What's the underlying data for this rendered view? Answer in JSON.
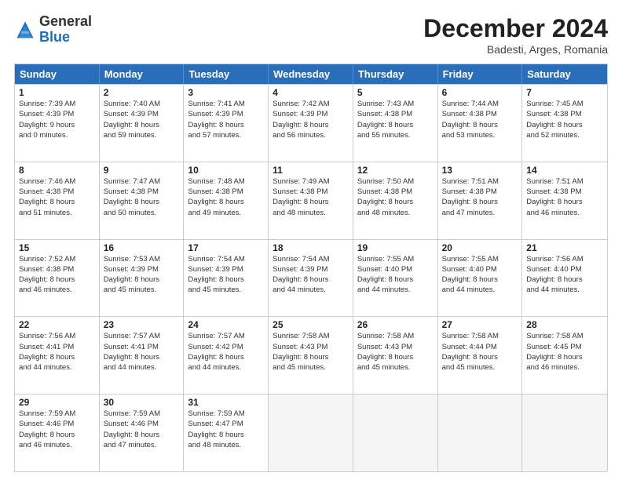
{
  "header": {
    "logo_general": "General",
    "logo_blue": "Blue",
    "month_title": "December 2024",
    "subtitle": "Badesti, Arges, Romania"
  },
  "days_of_week": [
    "Sunday",
    "Monday",
    "Tuesday",
    "Wednesday",
    "Thursday",
    "Friday",
    "Saturday"
  ],
  "weeks": [
    [
      {
        "day": "1",
        "lines": [
          "Sunrise: 7:39 AM",
          "Sunset: 4:39 PM",
          "Daylight: 9 hours",
          "and 0 minutes."
        ]
      },
      {
        "day": "2",
        "lines": [
          "Sunrise: 7:40 AM",
          "Sunset: 4:39 PM",
          "Daylight: 8 hours",
          "and 59 minutes."
        ]
      },
      {
        "day": "3",
        "lines": [
          "Sunrise: 7:41 AM",
          "Sunset: 4:39 PM",
          "Daylight: 8 hours",
          "and 57 minutes."
        ]
      },
      {
        "day": "4",
        "lines": [
          "Sunrise: 7:42 AM",
          "Sunset: 4:39 PM",
          "Daylight: 8 hours",
          "and 56 minutes."
        ]
      },
      {
        "day": "5",
        "lines": [
          "Sunrise: 7:43 AM",
          "Sunset: 4:38 PM",
          "Daylight: 8 hours",
          "and 55 minutes."
        ]
      },
      {
        "day": "6",
        "lines": [
          "Sunrise: 7:44 AM",
          "Sunset: 4:38 PM",
          "Daylight: 8 hours",
          "and 53 minutes."
        ]
      },
      {
        "day": "7",
        "lines": [
          "Sunrise: 7:45 AM",
          "Sunset: 4:38 PM",
          "Daylight: 8 hours",
          "and 52 minutes."
        ]
      }
    ],
    [
      {
        "day": "8",
        "lines": [
          "Sunrise: 7:46 AM",
          "Sunset: 4:38 PM",
          "Daylight: 8 hours",
          "and 51 minutes."
        ]
      },
      {
        "day": "9",
        "lines": [
          "Sunrise: 7:47 AM",
          "Sunset: 4:38 PM",
          "Daylight: 8 hours",
          "and 50 minutes."
        ]
      },
      {
        "day": "10",
        "lines": [
          "Sunrise: 7:48 AM",
          "Sunset: 4:38 PM",
          "Daylight: 8 hours",
          "and 49 minutes."
        ]
      },
      {
        "day": "11",
        "lines": [
          "Sunrise: 7:49 AM",
          "Sunset: 4:38 PM",
          "Daylight: 8 hours",
          "and 48 minutes."
        ]
      },
      {
        "day": "12",
        "lines": [
          "Sunrise: 7:50 AM",
          "Sunset: 4:38 PM",
          "Daylight: 8 hours",
          "and 48 minutes."
        ]
      },
      {
        "day": "13",
        "lines": [
          "Sunrise: 7:51 AM",
          "Sunset: 4:38 PM",
          "Daylight: 8 hours",
          "and 47 minutes."
        ]
      },
      {
        "day": "14",
        "lines": [
          "Sunrise: 7:51 AM",
          "Sunset: 4:38 PM",
          "Daylight: 8 hours",
          "and 46 minutes."
        ]
      }
    ],
    [
      {
        "day": "15",
        "lines": [
          "Sunrise: 7:52 AM",
          "Sunset: 4:38 PM",
          "Daylight: 8 hours",
          "and 46 minutes."
        ]
      },
      {
        "day": "16",
        "lines": [
          "Sunrise: 7:53 AM",
          "Sunset: 4:39 PM",
          "Daylight: 8 hours",
          "and 45 minutes."
        ]
      },
      {
        "day": "17",
        "lines": [
          "Sunrise: 7:54 AM",
          "Sunset: 4:39 PM",
          "Daylight: 8 hours",
          "and 45 minutes."
        ]
      },
      {
        "day": "18",
        "lines": [
          "Sunrise: 7:54 AM",
          "Sunset: 4:39 PM",
          "Daylight: 8 hours",
          "and 44 minutes."
        ]
      },
      {
        "day": "19",
        "lines": [
          "Sunrise: 7:55 AM",
          "Sunset: 4:40 PM",
          "Daylight: 8 hours",
          "and 44 minutes."
        ]
      },
      {
        "day": "20",
        "lines": [
          "Sunrise: 7:55 AM",
          "Sunset: 4:40 PM",
          "Daylight: 8 hours",
          "and 44 minutes."
        ]
      },
      {
        "day": "21",
        "lines": [
          "Sunrise: 7:56 AM",
          "Sunset: 4:40 PM",
          "Daylight: 8 hours",
          "and 44 minutes."
        ]
      }
    ],
    [
      {
        "day": "22",
        "lines": [
          "Sunrise: 7:56 AM",
          "Sunset: 4:41 PM",
          "Daylight: 8 hours",
          "and 44 minutes."
        ]
      },
      {
        "day": "23",
        "lines": [
          "Sunrise: 7:57 AM",
          "Sunset: 4:41 PM",
          "Daylight: 8 hours",
          "and 44 minutes."
        ]
      },
      {
        "day": "24",
        "lines": [
          "Sunrise: 7:57 AM",
          "Sunset: 4:42 PM",
          "Daylight: 8 hours",
          "and 44 minutes."
        ]
      },
      {
        "day": "25",
        "lines": [
          "Sunrise: 7:58 AM",
          "Sunset: 4:43 PM",
          "Daylight: 8 hours",
          "and 45 minutes."
        ]
      },
      {
        "day": "26",
        "lines": [
          "Sunrise: 7:58 AM",
          "Sunset: 4:43 PM",
          "Daylight: 8 hours",
          "and 45 minutes."
        ]
      },
      {
        "day": "27",
        "lines": [
          "Sunrise: 7:58 AM",
          "Sunset: 4:44 PM",
          "Daylight: 8 hours",
          "and 45 minutes."
        ]
      },
      {
        "day": "28",
        "lines": [
          "Sunrise: 7:58 AM",
          "Sunset: 4:45 PM",
          "Daylight: 8 hours",
          "and 46 minutes."
        ]
      }
    ],
    [
      {
        "day": "29",
        "lines": [
          "Sunrise: 7:59 AM",
          "Sunset: 4:46 PM",
          "Daylight: 8 hours",
          "and 46 minutes."
        ]
      },
      {
        "day": "30",
        "lines": [
          "Sunrise: 7:59 AM",
          "Sunset: 4:46 PM",
          "Daylight: 8 hours",
          "and 47 minutes."
        ]
      },
      {
        "day": "31",
        "lines": [
          "Sunrise: 7:59 AM",
          "Sunset: 4:47 PM",
          "Daylight: 8 hours",
          "and 48 minutes."
        ]
      },
      {
        "day": "",
        "lines": []
      },
      {
        "day": "",
        "lines": []
      },
      {
        "day": "",
        "lines": []
      },
      {
        "day": "",
        "lines": []
      }
    ]
  ]
}
